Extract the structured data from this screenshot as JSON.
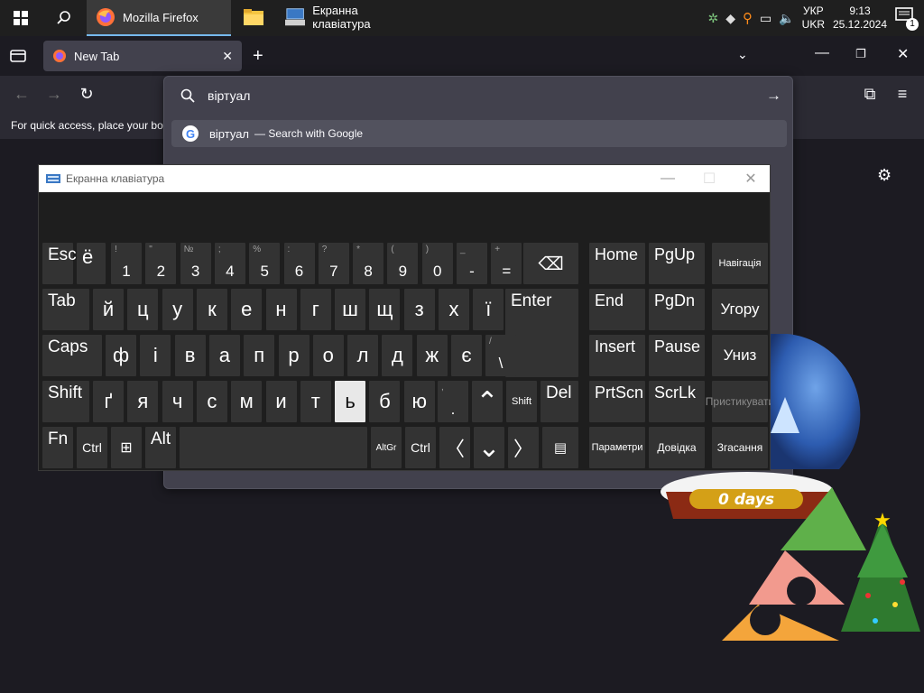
{
  "taskbar": {
    "apps": [
      {
        "label": "Mozilla Firefox",
        "active": true
      },
      {
        "label": "Екранна клавіатура",
        "active": false
      }
    ],
    "lang_top": "УКР",
    "lang_bottom": "UKR",
    "time": "9:13",
    "date": "25.12.2024",
    "notification_count": "1"
  },
  "firefox": {
    "tab_title": "New Tab",
    "bookmarks_hint": "For quick access, place your boo",
    "url_value": "віртуал",
    "suggestion_query": "віртуал",
    "suggestion_suffix": "— Search with Google"
  },
  "osk": {
    "title": "Екранна клавіатура",
    "rows": {
      "r1": [
        {
          "main": "Esc"
        },
        {
          "main": "ё"
        },
        {
          "sub": "!",
          "main": "1"
        },
        {
          "sub": "\"",
          "main": "2"
        },
        {
          "sub": "№",
          "main": "3"
        },
        {
          "sub": ";",
          "main": "4"
        },
        {
          "sub": "%",
          "main": "5"
        },
        {
          "sub": ":",
          "main": "6"
        },
        {
          "sub": "?",
          "main": "7"
        },
        {
          "sub": "*",
          "main": "8"
        },
        {
          "sub": "(",
          "main": "9"
        },
        {
          "sub": ")",
          "main": "0"
        },
        {
          "sub": "_",
          "main": "-"
        },
        {
          "sub": "+",
          "main": "="
        }
      ],
      "r2": [
        "Tab",
        "й",
        "ц",
        "у",
        "к",
        "е",
        "н",
        "г",
        "ш",
        "щ",
        "з",
        "х",
        "ї"
      ],
      "r3": [
        "Caps",
        "ф",
        "і",
        "в",
        "а",
        "п",
        "р",
        "о",
        "л",
        "д",
        "ж",
        "є"
      ],
      "r4": [
        "Shift",
        "ґ",
        "я",
        "ч",
        "с",
        "м",
        "и",
        "т",
        "ь",
        "б",
        "ю"
      ],
      "r5": [
        "Fn",
        "Ctrl",
        "Alt",
        "AltGr",
        "Ctrl"
      ],
      "enter": "Enter",
      "backslash_sub": "/",
      "backslash_main": "\\",
      "period_main": ".",
      "period_sub": ",",
      "shift_right": "Shift",
      "del": "Del",
      "nav": [
        [
          "Home",
          "PgUp",
          "Навігація"
        ],
        [
          "End",
          "PgDn",
          "Угору"
        ],
        [
          "Insert",
          "Pause",
          "Униз"
        ],
        [
          "PrtScn",
          "ScrLk",
          "Пристикувати"
        ],
        [
          "Параметри",
          "Довідка",
          "Згасання"
        ]
      ]
    }
  },
  "decoration": {
    "days_text": "0 days"
  }
}
